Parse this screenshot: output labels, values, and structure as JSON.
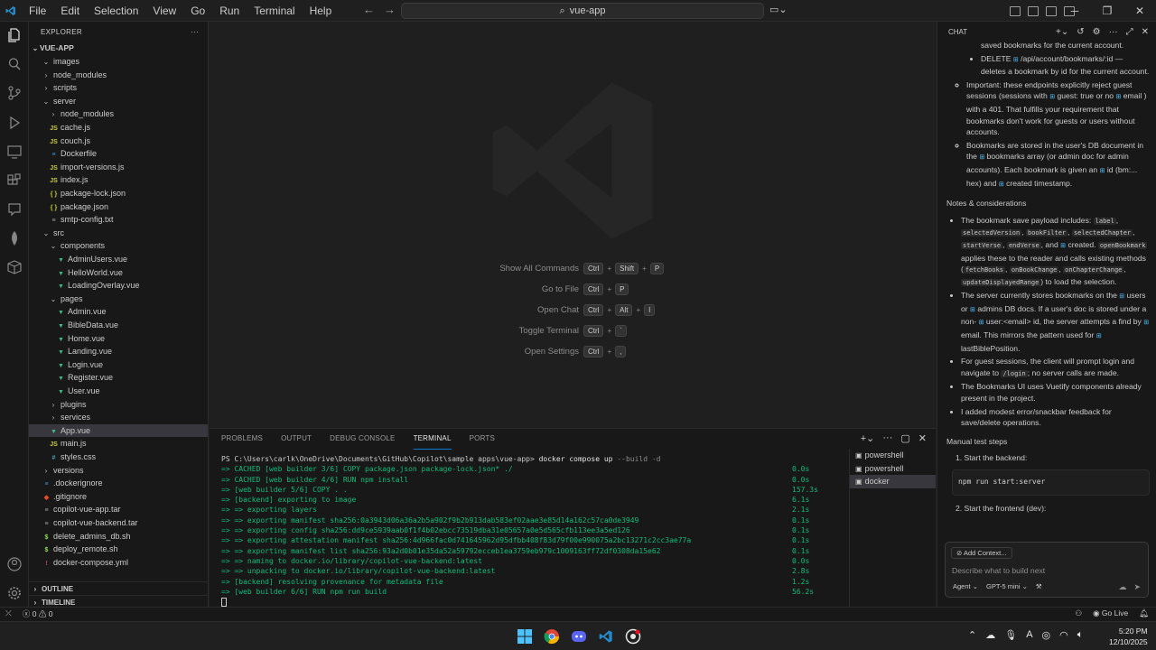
{
  "titlebar": {
    "menu": [
      "File",
      "Edit",
      "Selection",
      "View",
      "Go",
      "Run",
      "Terminal",
      "Help"
    ],
    "search_text": "vue-app"
  },
  "explorer": {
    "title": "EXPLORER",
    "root": "VUE-APP",
    "rows": [
      {
        "label": "images",
        "kind": "folder-open",
        "depth": 1
      },
      {
        "label": "node_modules",
        "kind": "folder",
        "depth": 1
      },
      {
        "label": "scripts",
        "kind": "folder",
        "depth": 1
      },
      {
        "label": "server",
        "kind": "folder-open",
        "depth": 1
      },
      {
        "label": "node_modules",
        "kind": "folder",
        "depth": 2
      },
      {
        "label": "cache.js",
        "kind": "js",
        "depth": 2
      },
      {
        "label": "couch.js",
        "kind": "js",
        "depth": 2
      },
      {
        "label": "Dockerfile",
        "kind": "docker",
        "depth": 2
      },
      {
        "label": "import-versions.js",
        "kind": "js",
        "depth": 2
      },
      {
        "label": "index.js",
        "kind": "js",
        "depth": 2
      },
      {
        "label": "package-lock.json",
        "kind": "json",
        "depth": 2
      },
      {
        "label": "package.json",
        "kind": "json",
        "depth": 2
      },
      {
        "label": "smtp-config.txt",
        "kind": "txt",
        "depth": 2
      },
      {
        "label": "src",
        "kind": "folder-open",
        "depth": 1
      },
      {
        "label": "components",
        "kind": "folder-open",
        "depth": 2
      },
      {
        "label": "AdminUsers.vue",
        "kind": "vue",
        "depth": 3
      },
      {
        "label": "HelloWorld.vue",
        "kind": "vue",
        "depth": 3
      },
      {
        "label": "LoadingOverlay.vue",
        "kind": "vue",
        "depth": 3
      },
      {
        "label": "pages",
        "kind": "folder-open",
        "depth": 2
      },
      {
        "label": "Admin.vue",
        "kind": "vue",
        "depth": 3
      },
      {
        "label": "BibleData.vue",
        "kind": "vue",
        "depth": 3
      },
      {
        "label": "Home.vue",
        "kind": "vue",
        "depth": 3
      },
      {
        "label": "Landing.vue",
        "kind": "vue",
        "depth": 3
      },
      {
        "label": "Login.vue",
        "kind": "vue",
        "depth": 3
      },
      {
        "label": "Register.vue",
        "kind": "vue",
        "depth": 3
      },
      {
        "label": "User.vue",
        "kind": "vue",
        "depth": 3
      },
      {
        "label": "plugins",
        "kind": "folder",
        "depth": 2
      },
      {
        "label": "services",
        "kind": "folder",
        "depth": 2
      },
      {
        "label": "App.vue",
        "kind": "vue",
        "depth": 2,
        "selected": true
      },
      {
        "label": "main.js",
        "kind": "js",
        "depth": 2
      },
      {
        "label": "styles.css",
        "kind": "css",
        "depth": 2
      },
      {
        "label": "versions",
        "kind": "folder",
        "depth": 1
      },
      {
        "label": ".dockerignore",
        "kind": "docker",
        "depth": 1
      },
      {
        "label": ".gitignore",
        "kind": "git",
        "depth": 1
      },
      {
        "label": "copilot-vue-app.tar",
        "kind": "tar",
        "depth": 1
      },
      {
        "label": "copilot-vue-backend.tar",
        "kind": "tar",
        "depth": 1
      },
      {
        "label": "delete_admins_db.sh",
        "kind": "sh",
        "depth": 1
      },
      {
        "label": "deploy_remote.sh",
        "kind": "sh",
        "depth": 1
      },
      {
        "label": "docker-compose.yml",
        "kind": "yml",
        "depth": 1
      }
    ],
    "outline": "OUTLINE",
    "timeline": "TIMELINE"
  },
  "editor": {
    "shortcuts": [
      {
        "label": "Show All Commands",
        "keys": [
          "Ctrl",
          "Shift",
          "P"
        ]
      },
      {
        "label": "Go to File",
        "keys": [
          "Ctrl",
          "P"
        ]
      },
      {
        "label": "Open Chat",
        "keys": [
          "Ctrl",
          "Alt",
          "I"
        ]
      },
      {
        "label": "Toggle Terminal",
        "keys": [
          "Ctrl",
          "`"
        ]
      },
      {
        "label": "Open Settings",
        "keys": [
          "Ctrl",
          ","
        ]
      }
    ]
  },
  "panel": {
    "tabs": [
      "PROBLEMS",
      "OUTPUT",
      "DEBUG CONSOLE",
      "TERMINAL",
      "PORTS"
    ],
    "active_tab": "TERMINAL",
    "prompt": "PS C:\\Users\\carlk\\OneDrive\\Documents\\GitHub\\Copilot\\sample apps\\vue-app>",
    "command": "docker compose up",
    "flags": "--build -d",
    "lines": [
      {
        "text": "=> CACHED [web builder 3/6] COPY package.json package-lock.json* ./",
        "time": "0.0s"
      },
      {
        "text": "=> CACHED [web builder 4/6] RUN npm install",
        "time": "0.0s"
      },
      {
        "text": "=> [web builder 5/6] COPY . .",
        "time": "157.3s"
      },
      {
        "text": "=> [backend] exporting to image",
        "time": "6.1s"
      },
      {
        "text": "=> => exporting layers",
        "time": "2.1s"
      },
      {
        "text": "=> => exporting manifest sha256:0a3943d06a36a2b5a902f9b2b913dab583ef02aae3e85d14a162c57ca0de3949",
        "time": "0.1s"
      },
      {
        "text": "=> => exporting config sha256:dd9ce5939aab0f1f4b02ebcc73519dba31e05657a0e5d565cfb113ee3a5ed126",
        "time": "0.1s"
      },
      {
        "text": "=> => exporting attestation manifest sha256:4d966fac0d741645962d95dfbb408f83d79f00e990075a2bc13271c2cc3ae77a",
        "time": "0.1s"
      },
      {
        "text": "=> => exporting manifest list sha256:93a2d0b01e35da52a59792ecceb1ea3759eb979c1009163ff72df0308da15e62",
        "time": "0.1s"
      },
      {
        "text": "=> => naming to docker.io/library/copilot-vue-backend:latest",
        "time": "0.0s"
      },
      {
        "text": "=> => unpacking to docker.io/library/copilot-vue-backend:latest",
        "time": "2.8s"
      },
      {
        "text": "=> [backend] resolving provenance for metadata file",
        "time": "1.2s"
      },
      {
        "text": "=> [web builder 6/6] RUN npm run build",
        "time": "56.2s"
      }
    ],
    "terminals": [
      "powershell",
      "powershell",
      "docker"
    ]
  },
  "chat": {
    "title": "CHAT",
    "frag1": "saved bookmarks for the current account.",
    "del_method": "DELETE",
    "del_path": "/api/account/bookmarks/:id",
    "del_desc": "— deletes a bookmark by id for the current account.",
    "imp1": "Important: these endpoints explicitly reject guest sessions (sessions with",
    "guest_code": "guest: true",
    "imp2": "or no",
    "email_code": "email",
    "imp3": ") with a 401. That fulfills your requirement that bookmarks don't work for guests or users without accounts.",
    "store1": "Bookmarks are stored in the user's DB document in the",
    "bookmarks_code": "bookmarks",
    "store2": "array (or admin doc for admin accounts). Each bookmark is given an",
    "id_code": "id",
    "store3": "(bm:... hex) and",
    "created_code": "created",
    "store4": "timestamp.",
    "notes_heading": "Notes & considerations",
    "n1a": "The bookmark save payload includes:",
    "n1_codes": [
      "label",
      "selectedVersion",
      "bookFilter",
      "selectedChapter",
      "startVerse",
      "endVerse"
    ],
    "n1b": ", and",
    "n1_created": "created",
    "n1_open": "openBookmark",
    "n1c": "applies these to the reader and calls existing methods (",
    "n1_methods": [
      "fetchBooks",
      "onBookChange",
      "onChapterChange",
      "updateDisplayedRange"
    ],
    "n1d": ") to load the selection.",
    "n2a": "The server currently stores bookmarks on the",
    "users_code": "users",
    "n2b": "or",
    "admins_code": "admins",
    "n2c": "DB docs. If a user's doc is stored under a non-",
    "user_email_code": "user:<email>",
    "n2d": "id, the server attempts a find by",
    "n2_email": "email",
    "n2e": ". This mirrors the pattern used for",
    "last_code": "lastBiblePosition",
    "n3a": "For guest sessions, the client will prompt login and navigate to",
    "login_code": "/login",
    "n3b": "; no server calls are made.",
    "n4": "The Bookmarks UI uses Vuetify components already present in the project.",
    "n5": "I added modest error/snackbar feedback for save/delete operations.",
    "manual_heading": "Manual test steps",
    "step1": "1. Start the backend:",
    "step1_code": "npm run start:server",
    "step2": "2. Start the frontend (dev):",
    "add_context": "Add Context...",
    "input_placeholder": "Describe what to build next",
    "agent": "Agent",
    "model": "GPT-5 mini"
  },
  "status": {
    "errors": "0",
    "warnings": "0",
    "golive": "Go Live"
  },
  "taskbar": {
    "time": "5:20 PM",
    "date": "12/10/2025"
  }
}
